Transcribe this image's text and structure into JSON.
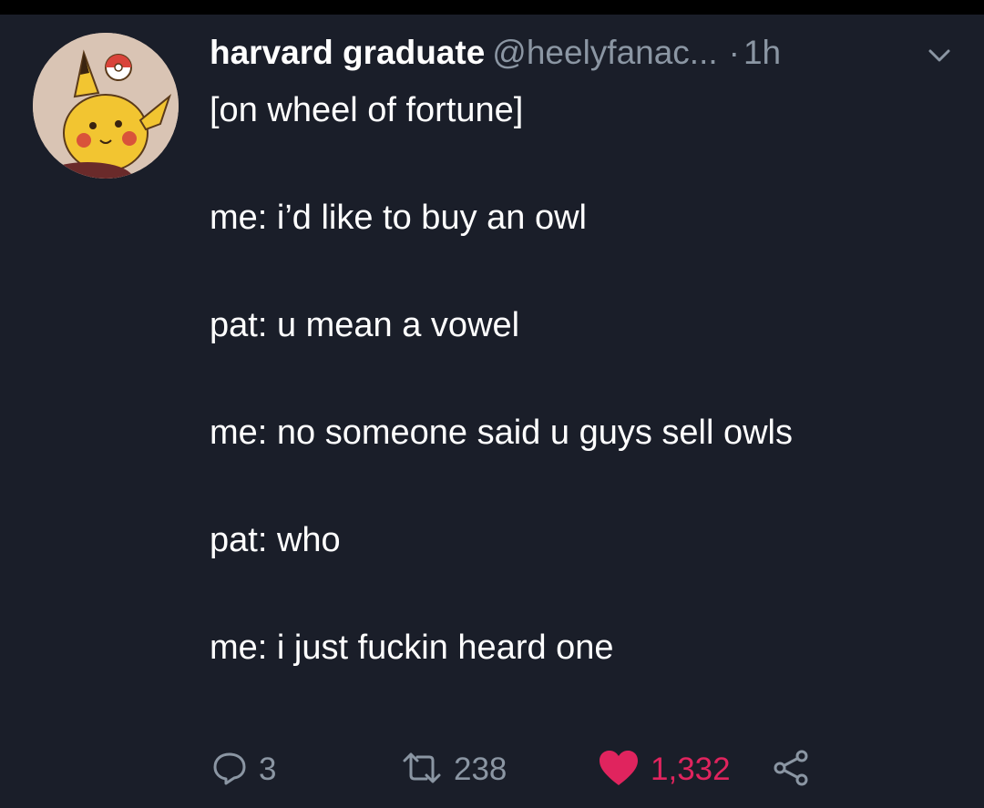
{
  "tweet": {
    "display_name": "harvard graduate",
    "handle": "@heelyfanac...",
    "separator": "·",
    "time": "1h",
    "lines": [
      "[on wheel of fortune]",
      "me: i’d like to buy an owl",
      "pat: u mean a vowel",
      "me: no someone said u guys sell owls",
      "pat: who",
      "me: i just fuckin heard one"
    ]
  },
  "actions": {
    "replies": "3",
    "retweets": "238",
    "likes": "1,332"
  },
  "icons": {
    "more": "chevron-down-icon",
    "reply": "reply-icon",
    "retweet": "retweet-icon",
    "like": "heart-icon",
    "share": "share-icon"
  },
  "colors": {
    "background": "#1a1e29",
    "secondary_text": "#8b96a3",
    "like": "#e0245e"
  }
}
